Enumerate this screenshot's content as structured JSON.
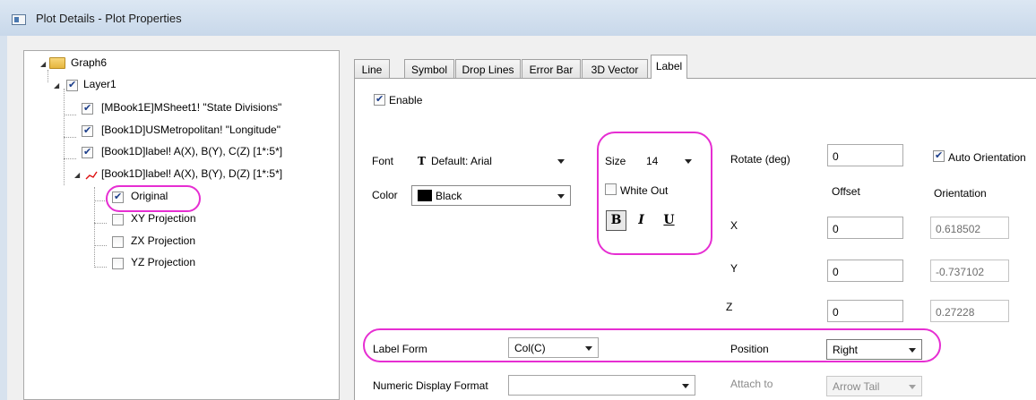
{
  "window": {
    "title": "Plot Details - Plot Properties"
  },
  "tree": {
    "graph": "Graph6",
    "layer": "Layer1",
    "plots": [
      "[MBook1E]MSheet1! \"State Divisions\"",
      "[Book1D]USMetropolitan! \"Longitude\"",
      "[Book1D]label! A(X), B(Y), C(Z) [1*:5*]",
      "[Book1D]label! A(X), B(Y), D(Z) [1*:5*]"
    ],
    "subplots": [
      "Original",
      "XY Projection",
      "ZX Projection",
      "YZ Projection"
    ]
  },
  "tabs": [
    "Line",
    "Symbol",
    "Drop Lines",
    "Error Bar",
    "3D Vector",
    "Label"
  ],
  "label_tab": {
    "enable": "Enable",
    "font_label": "Font",
    "font_value": "Default: Arial",
    "color_label": "Color",
    "color_value": "Black",
    "size_label": "Size",
    "size_value": "14",
    "white_out": "White Out",
    "bold": "B",
    "italic": "I",
    "underline": "U",
    "rotate_label": "Rotate (deg)",
    "rotate_value": "0",
    "auto_orientation": "Auto Orientation",
    "offset_header": "Offset",
    "orientation_header": "Orientation",
    "x_label": "X",
    "x_offset": "0",
    "x_orientation": "0.618502",
    "y_label": "Y",
    "y_offset": "0",
    "y_orientation": "-0.737102",
    "z_label": "Z",
    "z_offset": "0",
    "z_orientation": "0.27228",
    "label_form_label": "Label Form",
    "label_form_value": "Col(C)",
    "position_label": "Position",
    "position_value": "Right",
    "numeric_format_label": "Numeric Display Format",
    "numeric_format_value": "",
    "attach_label": "Attach to",
    "attach_value": "Arrow Tail"
  },
  "colors": {
    "highlight": "#e62ed2",
    "check": "#1b3d8a"
  }
}
